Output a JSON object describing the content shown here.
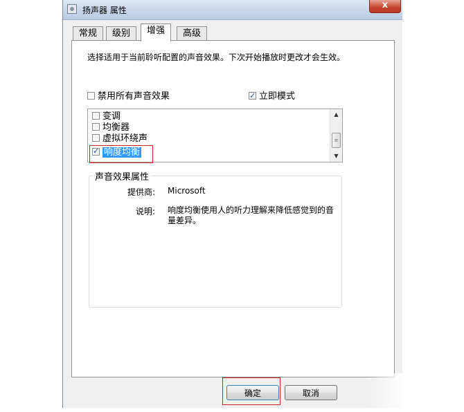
{
  "window": {
    "title": "扬声器 属性",
    "close_glyph": "x"
  },
  "tabs": [
    {
      "label": "常规"
    },
    {
      "label": "级别"
    },
    {
      "label": "增强"
    },
    {
      "label": "高级"
    }
  ],
  "enhancements": {
    "description": "选择适用于当前聆听配置的声音效果。下次开始播放时更改才会生效。",
    "disable_all": {
      "label": "禁用所有声音效果",
      "checked": false
    },
    "immediate_mode": {
      "label": "立即模式",
      "checked": true
    },
    "effects": [
      {
        "label": "变调",
        "checked": false
      },
      {
        "label": "均衡器",
        "checked": false
      },
      {
        "label": "虚拟环绕声",
        "checked": false
      },
      {
        "label": "响度均衡",
        "checked": true,
        "selected": true
      }
    ]
  },
  "properties": {
    "legend": "声音效果属性",
    "provider_label": "提供商:",
    "provider_value": "Microsoft",
    "description_label": "说明:",
    "description_value": "响度均衡使用人的听力理解来降低感觉到的音量差异。"
  },
  "buttons": {
    "ok": "确定",
    "cancel": "取消"
  },
  "icons": {
    "scroll_up": "▲",
    "scroll_down": "▼",
    "scroll_grip": "≡"
  }
}
